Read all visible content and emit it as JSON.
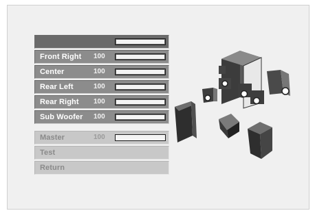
{
  "menu": {
    "items": [
      {
        "label": "",
        "value": "",
        "level": 1.0
      },
      {
        "label": "Front Right",
        "value": "100",
        "level": 1.0
      },
      {
        "label": "Center",
        "value": "100",
        "level": 1.0
      },
      {
        "label": "Rear Left",
        "value": "100",
        "level": 1.0
      },
      {
        "label": "Rear Right",
        "value": "100",
        "level": 1.0
      },
      {
        "label": "Sub Woofer",
        "value": "100",
        "level": 1.0
      }
    ],
    "master": {
      "label": "Master",
      "value": "100",
      "level": 1.0
    },
    "test_label": "Test",
    "return_label": "Return"
  },
  "colors": {
    "background": "#f0f0f0",
    "row": "#8c8c8c",
    "row_selected": "#6a6a6a",
    "row_dimmed": "#c8c8c8",
    "bar_fill": "#f4f4f4",
    "speaker_dark": "#444444"
  },
  "illustration": {
    "icon": "speaker-layout-icon"
  }
}
